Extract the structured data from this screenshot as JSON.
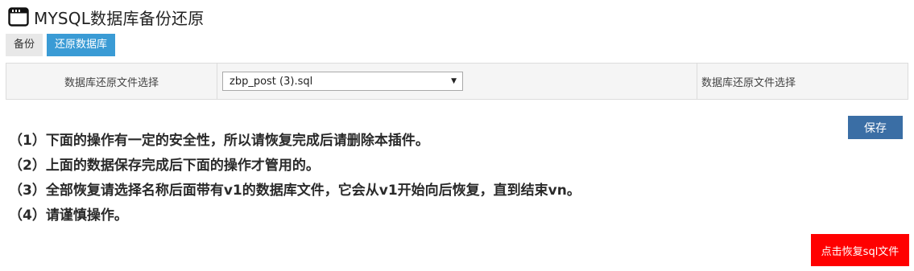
{
  "header": {
    "title": "MYSQL数据库备份还原",
    "icon": "window-icon"
  },
  "tabs": [
    {
      "label": "备份",
      "active": false
    },
    {
      "label": "还原数据库",
      "active": true
    }
  ],
  "settings": {
    "row_label": "数据库还原文件选择",
    "selected_file": "zbp_post (3).sql",
    "row_note": "数据库还原文件选择"
  },
  "actions": {
    "save_label": "保存",
    "restore_label": "点击恢复sql文件"
  },
  "instructions": [
    "（1）下面的操作有一定的安全性，所以请恢复完成后请删除本插件。",
    "（2）上面的数据保存完成后下面的操作才管用的。",
    "（3）全部恢复请选择名称后面带有v1的数据库文件，它会从v1开始向后恢复，直到结束vn。",
    "（4）请谨慎操作。"
  ],
  "colors": {
    "active_tab": "#3a9bd5",
    "save_button": "#3a6ea5",
    "restore_button": "#ff0000"
  }
}
